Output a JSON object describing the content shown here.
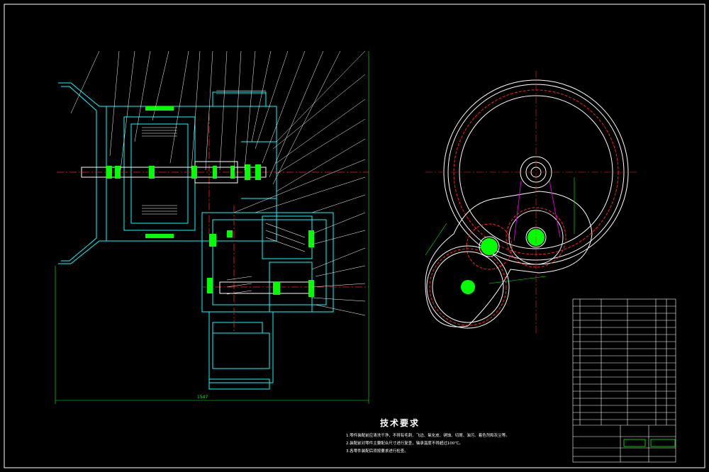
{
  "drawing": {
    "tech_title": "技术要求",
    "tech_notes": [
      "1.零件装配前应清洗干净，不得有毛刺、飞边、氧化皮、锈蚀、切屑、油污、着色剂和灰尘等。",
      "2.装配前对零件主要配合尺寸进行复查，轴承温度不得超过100℃。",
      "3.各零件装配后须按要求进行检查。"
    ],
    "dimension_overall": "1547",
    "colors": {
      "background": "#000000",
      "outline": "#ffffff",
      "gear_fill": "#00ff00",
      "section": "#00ffff",
      "centerline": "#ff2020",
      "link": "#cc00cc"
    }
  }
}
